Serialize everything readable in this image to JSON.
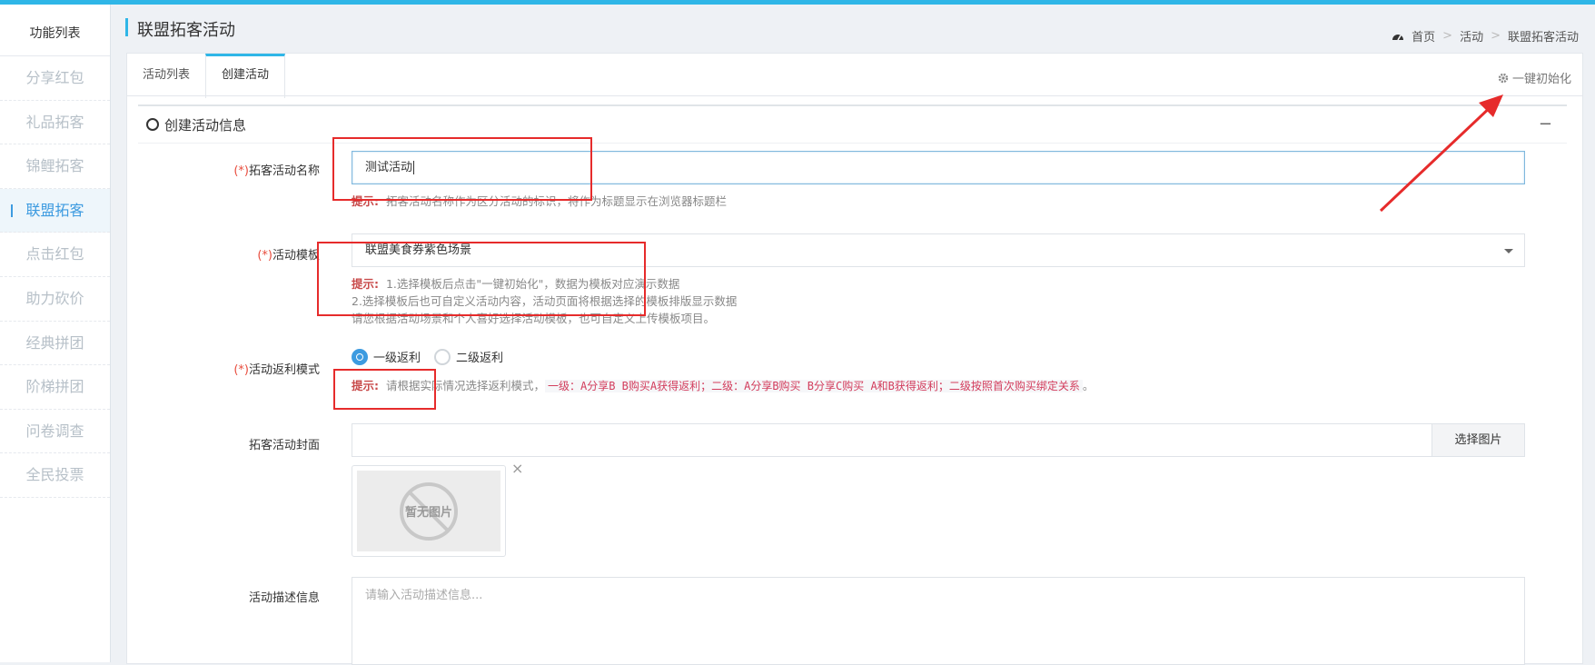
{
  "sidebar": {
    "title": "功能列表",
    "items": [
      {
        "label": "分享红包"
      },
      {
        "label": "礼品拓客"
      },
      {
        "label": "锦鲤拓客"
      },
      {
        "label": "联盟拓客",
        "active": true
      },
      {
        "label": "点击红包"
      },
      {
        "label": "助力砍价"
      },
      {
        "label": "经典拼团"
      },
      {
        "label": "阶梯拼团"
      },
      {
        "label": "问卷调查"
      },
      {
        "label": "全民投票"
      }
    ]
  },
  "header": {
    "title": "联盟拓客活动",
    "breadcrumb": [
      "首页",
      "活动",
      "联盟拓客活动"
    ],
    "breadcrumb_sep": ">"
  },
  "tabs": [
    {
      "label": "活动列表",
      "active": false
    },
    {
      "label": "创建活动",
      "active": true
    }
  ],
  "init_link": "一键初始化",
  "section": {
    "title": "创建活动信息",
    "collapse": "−"
  },
  "form": {
    "required_mark": "(*)",
    "name": {
      "label": "拓客活动名称",
      "value": "测试活动",
      "hint_prefix": "提示:",
      "hint": "拓客活动名称作为区分活动的标识，将作为标题显示在浏览器标题栏"
    },
    "template": {
      "label": "活动模板",
      "value": "联盟美食券紫色场景",
      "hint_prefix": "提示:",
      "hint_lines": [
        "1.选择模板后点击\"一键初始化\"，数据为模板对应演示数据",
        "2.选择模板后也可自定义活动内容，活动页面将根据选择的模板排版显示数据",
        "请您根据活动场景和个人喜好选择活动模板，也可自定义上传模板项目。"
      ]
    },
    "mode": {
      "label": "活动返利模式",
      "options": [
        "一级返利",
        "二级返利"
      ],
      "selected": "一级返利",
      "hint_prefix": "提示:",
      "hint_text": "请根据实际情况选择返利模式，",
      "hint_code": "一级：A分享B B购买A获得返利；二级：A分享B购买 B分享C购买 A和B获得返利；二级按照首次购买绑定关系",
      "hint_end": "。"
    },
    "cover": {
      "label": "拓客活动封面",
      "value": "",
      "button": "选择图片",
      "placeholder_image_text": "暂无图片",
      "remove": "×"
    },
    "description": {
      "label": "活动描述信息",
      "placeholder": "请输入活动描述信息..."
    }
  },
  "colors": {
    "accent": "#2fb6e7",
    "link_blue": "#3d9be0",
    "annotation_red": "#e62b2b"
  }
}
